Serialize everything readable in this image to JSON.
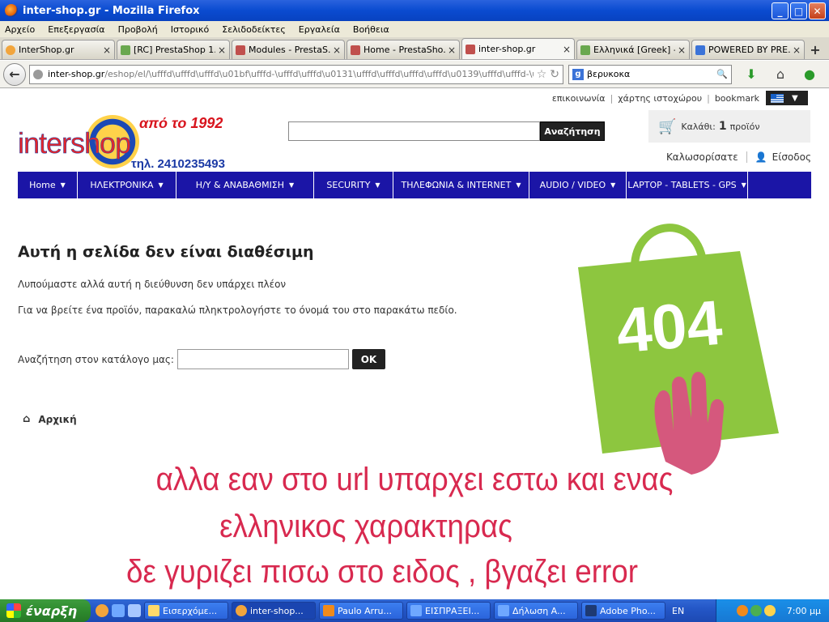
{
  "window": {
    "title": "inter-shop.gr - Mozilla Firefox",
    "buttons": {
      "minimize": "_",
      "maximize": "□",
      "close": "✕"
    }
  },
  "menu": [
    "Αρχείο",
    "Επεξεργασία",
    "Προβολή",
    "Ιστορικό",
    "Σελιδοδείκτες",
    "Εργαλεία",
    "Βοήθεια"
  ],
  "tabs": [
    {
      "label": "InterShop.gr",
      "icon_color": "#f2a53c"
    },
    {
      "label": "[RC] PrestaShop 1...",
      "icon_color": "#6aa84f"
    },
    {
      "label": "Modules - PrestaS...",
      "icon_color": "#c0504d"
    },
    {
      "label": "Home - PrestaSho...",
      "icon_color": "#c0504d"
    },
    {
      "label": "inter-shop.gr",
      "icon_color": "#c0504d",
      "active": true
    },
    {
      "label": "Ελληνικά [Greek] -...",
      "icon_color": "#6aa84f"
    },
    {
      "label": "POWERED BY PRE...",
      "icon_color": "#3b73d8"
    }
  ],
  "navbar": {
    "url_host": "inter-shop.gr",
    "url_path": "/eshop/el/\\ufffd\\ufffd\\ufffd\\u01bf\\ufffd-\\ufffd\\ufffd\\u0131\\ufffd\\ufffd\\ufffd\\ufffd\\u0139\\ufffd\\ufffd-\\uf",
    "search_value": "βερυκοκα",
    "search_engine_letter": "g"
  },
  "page": {
    "toplinks": [
      "επικοινωνία",
      "χάρτης ιστοχώρου",
      "bookmark"
    ],
    "logo": {
      "word": "intershop",
      "since": "από το 1992",
      "phone": "τηλ. 2410235493"
    },
    "search_button": "Αναζήτηση",
    "cart": {
      "label": "Καλάθι:",
      "count": "1",
      "unit": "προϊόν"
    },
    "welcome": "Καλωσορίσατε",
    "login": "Είσοδος",
    "nav": [
      "Home",
      "ΗΛΕΚΤΡΟΝΙΚΑ",
      "Η/Υ & ΑΝΑΒΑΘΜΙΣΗ",
      "SECURITY",
      "ΤΗΛΕΦΩΝΙΑ & INTERNET",
      "AUDIO / VIDEO",
      "LAPTOP - TABLETS - GPS"
    ],
    "heading": "Αυτή η σελίδα δεν είναι διαθέσιμη",
    "para1": "Λυπούμαστε αλλά αυτή η διεύθυνση δεν υπάρχει πλέον",
    "para2": "Για να βρείτε ένα προϊόν, παρακαλώ πληκτρολογήστε το όνομά του στο παρακάτω πεδίο.",
    "catalog_label": "Αναζήτηση στον κατάλογο μας:",
    "ok_button": "OK",
    "home_link": "Αρχική",
    "error_code": "404",
    "bag_color": "#8dc63f",
    "hand_color": "#d5587d",
    "annotation": [
      "αλλα εαν στο url υπαρχει εστω και ενας",
      "ελληνικος χαρακτηρας",
      "δε γυριζει πισω στο ειδος , βγαζει error"
    ]
  },
  "taskbar": {
    "start": "έναρξη",
    "tasks": [
      {
        "label": "Εισερχόμε..."
      },
      {
        "label": "inter-shop...",
        "active": true
      },
      {
        "label": "Paulo Arru..."
      },
      {
        "label": "ΕΙΣΠΡΑΞΕΙ..."
      },
      {
        "label": "Δήλωση Α..."
      },
      {
        "label": "Adobe Pho..."
      }
    ],
    "lang": "EN",
    "clock": "7:00 μμ"
  }
}
